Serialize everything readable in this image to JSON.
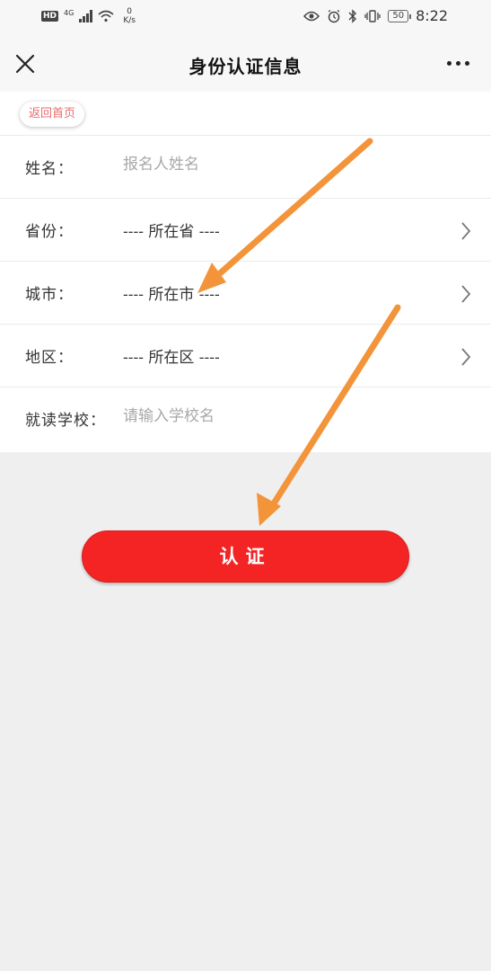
{
  "status_bar": {
    "hd": "HD",
    "network_type": "4G",
    "speed_value": "0",
    "speed_unit": "K/s",
    "battery": "50",
    "time": "8:22"
  },
  "nav": {
    "title": "身份认证信息"
  },
  "home_button_label": "返回首页",
  "form": {
    "name": {
      "label": "姓名：",
      "placeholder": "报名人姓名"
    },
    "province": {
      "label": "省份：",
      "value": "---- 所在省 ----"
    },
    "city": {
      "label": "城市：",
      "value": "---- 所在市 ----"
    },
    "district": {
      "label": "地区：",
      "value": "---- 所在区 ----"
    },
    "school": {
      "label": "就读学校：",
      "placeholder": "请输入学校名"
    }
  },
  "submit_label": "认证",
  "colors": {
    "accent_red": "#f42424",
    "home_text": "#e86b6b",
    "annotation_orange": "#f3943a"
  }
}
